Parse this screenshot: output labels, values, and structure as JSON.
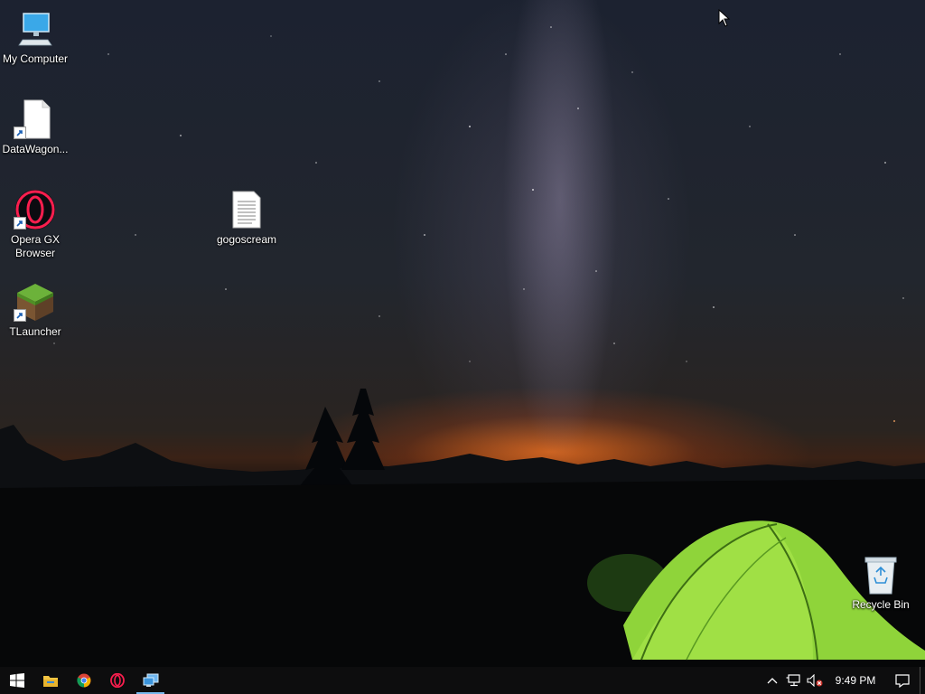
{
  "desktop": {
    "icons": [
      {
        "label": "My Computer",
        "icon": "computer-icon"
      },
      {
        "label": "DataWagon...",
        "icon": "document-shortcut-icon"
      },
      {
        "label": "Opera GX Browser",
        "icon": "opera-gx-icon"
      },
      {
        "label": "TLauncher",
        "icon": "minecraft-grass-block-icon"
      },
      {
        "label": "gogoscream",
        "icon": "text-file-icon"
      },
      {
        "label": "Recycle Bin",
        "icon": "recycle-bin-icon"
      }
    ]
  },
  "taskbar": {
    "pinned": [
      {
        "name": "start",
        "icon": "windows-logo-icon"
      },
      {
        "name": "file-explorer",
        "icon": "folder-icon"
      },
      {
        "name": "chrome",
        "icon": "chrome-icon"
      },
      {
        "name": "opera",
        "icon": "opera-icon"
      },
      {
        "name": "remote-desktop",
        "icon": "remote-desktop-icon",
        "active": true
      }
    ],
    "tray": {
      "clock": "9:49 PM",
      "icons": [
        "chevron-up-icon",
        "network-icon",
        "volume-muted-icon",
        "action-center-icon"
      ]
    }
  },
  "colors": {
    "taskbar": "#0d0d0e",
    "active_indicator": "#76b9ed",
    "tent": "#8fd43a",
    "sunset": "#eb6e1e"
  }
}
